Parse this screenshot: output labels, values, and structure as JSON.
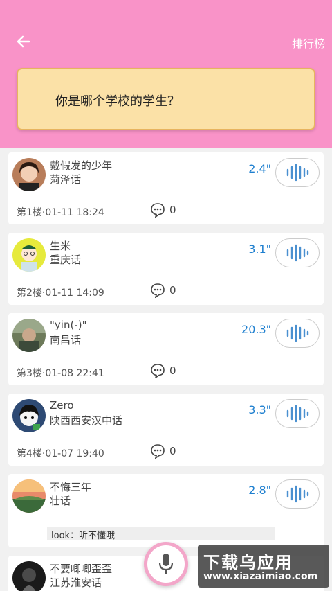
{
  "header": {
    "rank_label": "排行榜",
    "question": "你是哪个学校的学生？",
    "bg_color": "#f993c8"
  },
  "posts": [
    {
      "name": "戴假发的少年",
      "dialect": "菏泽话",
      "duration": "2.4\"",
      "floor": "第1楼·01-11 18:24",
      "comments": "0",
      "reply": ""
    },
    {
      "name": "生米",
      "dialect": "重庆话",
      "duration": "3.1\"",
      "floor": "第2楼·01-11 14:09",
      "comments": "0",
      "reply": ""
    },
    {
      "name": "\"yin(-)\"",
      "dialect": "南昌话",
      "duration": "20.3\"",
      "floor": "第3楼·01-08 22:41",
      "comments": "0",
      "reply": ""
    },
    {
      "name": "Zero",
      "dialect": "陕西西安汉中话",
      "duration": "3.3\"",
      "floor": "第4楼·01-07 19:40",
      "comments": "0",
      "reply": ""
    },
    {
      "name": "不悔三年",
      "dialect": "壮话",
      "duration": "2.8\"",
      "floor": "",
      "comments": "",
      "reply": "look：听不懂哦"
    },
    {
      "name": "不要唧唧歪歪",
      "dialect": "江苏淮安话",
      "duration": "",
      "floor": "",
      "comments": "",
      "reply": ""
    }
  ],
  "watermark": {
    "title": "下载乌应用",
    "url": "www.xiazaimiao.com"
  },
  "icons": {
    "back": "arrow-left-icon",
    "play": "voice-wave-icon",
    "comment": "comment-bubble-icon",
    "mic": "microphone-icon"
  }
}
